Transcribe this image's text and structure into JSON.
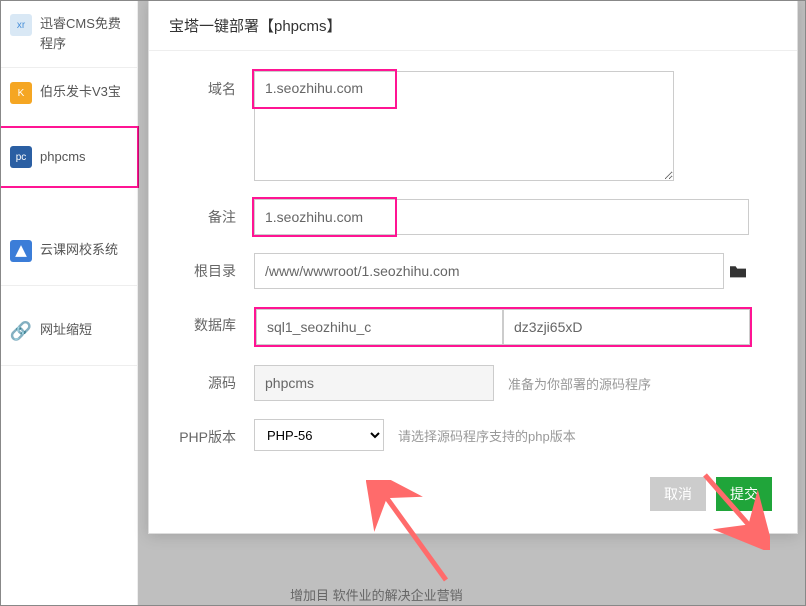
{
  "sidebar": {
    "items": [
      {
        "label": "迅睿CMS免费程序"
      },
      {
        "label": "伯乐发卡V3宝"
      },
      {
        "label": "phpcms"
      },
      {
        "label": "云课网校系统"
      },
      {
        "label": "网址缩短"
      }
    ]
  },
  "modal": {
    "title": "宝塔一键部署【phpcms】"
  },
  "form": {
    "domain_label": "域名",
    "domain_value": "1.seozhihu.com",
    "remark_label": "备注",
    "remark_value": "1.seozhihu.com",
    "root_label": "根目录",
    "root_value": "/www/wwwroot/1.seozhihu.com",
    "db_label": "数据库",
    "db_name": "sql1_seozhihu_c",
    "db_pass": "dz3zji65xD",
    "source_label": "源码",
    "source_value": "phpcms",
    "source_hint": "准备为你部署的源码程序",
    "php_label": "PHP版本",
    "php_value": "PHP-56",
    "php_hint": "请选择源码程序支持的php版本"
  },
  "buttons": {
    "cancel": "取消",
    "submit": "提交"
  },
  "footer_text": "增加目    软件业的解决企业营销"
}
